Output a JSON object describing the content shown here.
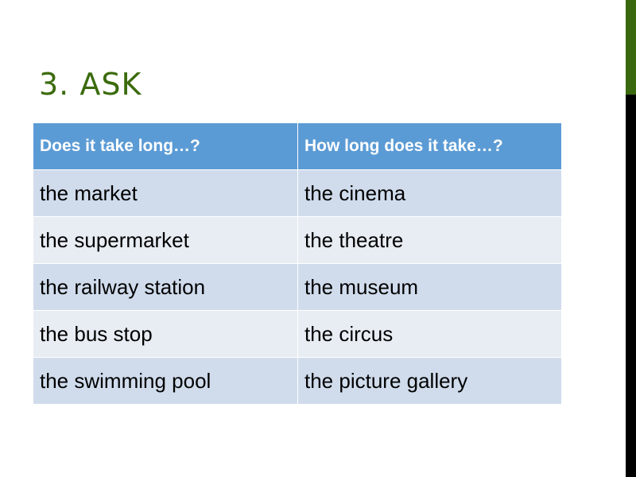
{
  "slide": {
    "title": "3. ASK",
    "accent_color": "#3a680f",
    "header_color": "#5b9bd5"
  },
  "table": {
    "headers": [
      "Does it take long…?",
      "How long does it take…?"
    ],
    "rows": [
      [
        "the market",
        "the cinema"
      ],
      [
        "the supermarket",
        "the theatre"
      ],
      [
        "the railway station",
        "the museum"
      ],
      [
        "the bus stop",
        "the circus"
      ],
      [
        "the swimming pool",
        "the picture gallery"
      ]
    ]
  }
}
